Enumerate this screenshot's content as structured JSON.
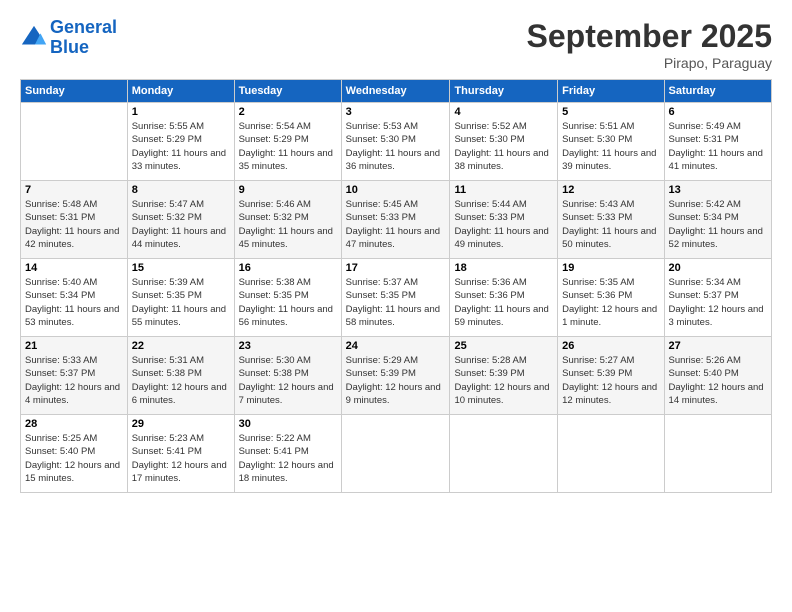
{
  "header": {
    "logo_line1": "General",
    "logo_line2": "Blue",
    "month": "September 2025",
    "location": "Pirapo, Paraguay"
  },
  "days_of_week": [
    "Sunday",
    "Monday",
    "Tuesday",
    "Wednesday",
    "Thursday",
    "Friday",
    "Saturday"
  ],
  "weeks": [
    [
      {
        "day": "",
        "empty": true
      },
      {
        "day": "1",
        "sunrise": "5:55 AM",
        "sunset": "5:29 PM",
        "daylight": "11 hours and 33 minutes."
      },
      {
        "day": "2",
        "sunrise": "5:54 AM",
        "sunset": "5:29 PM",
        "daylight": "11 hours and 35 minutes."
      },
      {
        "day": "3",
        "sunrise": "5:53 AM",
        "sunset": "5:30 PM",
        "daylight": "11 hours and 36 minutes."
      },
      {
        "day": "4",
        "sunrise": "5:52 AM",
        "sunset": "5:30 PM",
        "daylight": "11 hours and 38 minutes."
      },
      {
        "day": "5",
        "sunrise": "5:51 AM",
        "sunset": "5:30 PM",
        "daylight": "11 hours and 39 minutes."
      },
      {
        "day": "6",
        "sunrise": "5:49 AM",
        "sunset": "5:31 PM",
        "daylight": "11 hours and 41 minutes."
      }
    ],
    [
      {
        "day": "7",
        "sunrise": "5:48 AM",
        "sunset": "5:31 PM",
        "daylight": "11 hours and 42 minutes."
      },
      {
        "day": "8",
        "sunrise": "5:47 AM",
        "sunset": "5:32 PM",
        "daylight": "11 hours and 44 minutes."
      },
      {
        "day": "9",
        "sunrise": "5:46 AM",
        "sunset": "5:32 PM",
        "daylight": "11 hours and 45 minutes."
      },
      {
        "day": "10",
        "sunrise": "5:45 AM",
        "sunset": "5:33 PM",
        "daylight": "11 hours and 47 minutes."
      },
      {
        "day": "11",
        "sunrise": "5:44 AM",
        "sunset": "5:33 PM",
        "daylight": "11 hours and 49 minutes."
      },
      {
        "day": "12",
        "sunrise": "5:43 AM",
        "sunset": "5:33 PM",
        "daylight": "11 hours and 50 minutes."
      },
      {
        "day": "13",
        "sunrise": "5:42 AM",
        "sunset": "5:34 PM",
        "daylight": "11 hours and 52 minutes."
      }
    ],
    [
      {
        "day": "14",
        "sunrise": "5:40 AM",
        "sunset": "5:34 PM",
        "daylight": "11 hours and 53 minutes."
      },
      {
        "day": "15",
        "sunrise": "5:39 AM",
        "sunset": "5:35 PM",
        "daylight": "11 hours and 55 minutes."
      },
      {
        "day": "16",
        "sunrise": "5:38 AM",
        "sunset": "5:35 PM",
        "daylight": "11 hours and 56 minutes."
      },
      {
        "day": "17",
        "sunrise": "5:37 AM",
        "sunset": "5:35 PM",
        "daylight": "11 hours and 58 minutes."
      },
      {
        "day": "18",
        "sunrise": "5:36 AM",
        "sunset": "5:36 PM",
        "daylight": "11 hours and 59 minutes."
      },
      {
        "day": "19",
        "sunrise": "5:35 AM",
        "sunset": "5:36 PM",
        "daylight": "12 hours and 1 minute."
      },
      {
        "day": "20",
        "sunrise": "5:34 AM",
        "sunset": "5:37 PM",
        "daylight": "12 hours and 3 minutes."
      }
    ],
    [
      {
        "day": "21",
        "sunrise": "5:33 AM",
        "sunset": "5:37 PM",
        "daylight": "12 hours and 4 minutes."
      },
      {
        "day": "22",
        "sunrise": "5:31 AM",
        "sunset": "5:38 PM",
        "daylight": "12 hours and 6 minutes."
      },
      {
        "day": "23",
        "sunrise": "5:30 AM",
        "sunset": "5:38 PM",
        "daylight": "12 hours and 7 minutes."
      },
      {
        "day": "24",
        "sunrise": "5:29 AM",
        "sunset": "5:39 PM",
        "daylight": "12 hours and 9 minutes."
      },
      {
        "day": "25",
        "sunrise": "5:28 AM",
        "sunset": "5:39 PM",
        "daylight": "12 hours and 10 minutes."
      },
      {
        "day": "26",
        "sunrise": "5:27 AM",
        "sunset": "5:39 PM",
        "daylight": "12 hours and 12 minutes."
      },
      {
        "day": "27",
        "sunrise": "5:26 AM",
        "sunset": "5:40 PM",
        "daylight": "12 hours and 14 minutes."
      }
    ],
    [
      {
        "day": "28",
        "sunrise": "5:25 AM",
        "sunset": "5:40 PM",
        "daylight": "12 hours and 15 minutes."
      },
      {
        "day": "29",
        "sunrise": "5:23 AM",
        "sunset": "5:41 PM",
        "daylight": "12 hours and 17 minutes."
      },
      {
        "day": "30",
        "sunrise": "5:22 AM",
        "sunset": "5:41 PM",
        "daylight": "12 hours and 18 minutes."
      },
      {
        "day": "",
        "empty": true
      },
      {
        "day": "",
        "empty": true
      },
      {
        "day": "",
        "empty": true
      },
      {
        "day": "",
        "empty": true
      }
    ]
  ],
  "labels": {
    "sunrise_prefix": "Sunrise: ",
    "sunset_prefix": "Sunset: ",
    "daylight_prefix": "Daylight: "
  }
}
